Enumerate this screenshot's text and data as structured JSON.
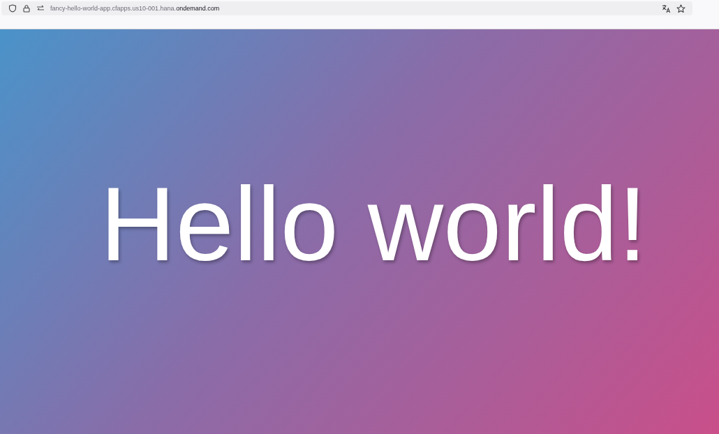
{
  "address_bar": {
    "url_subdomain": "fancy-hello-world-app.cfapps.us10-001.hana.",
    "url_domain": "ondemand.com"
  },
  "page": {
    "heading": "Hello world!"
  }
}
